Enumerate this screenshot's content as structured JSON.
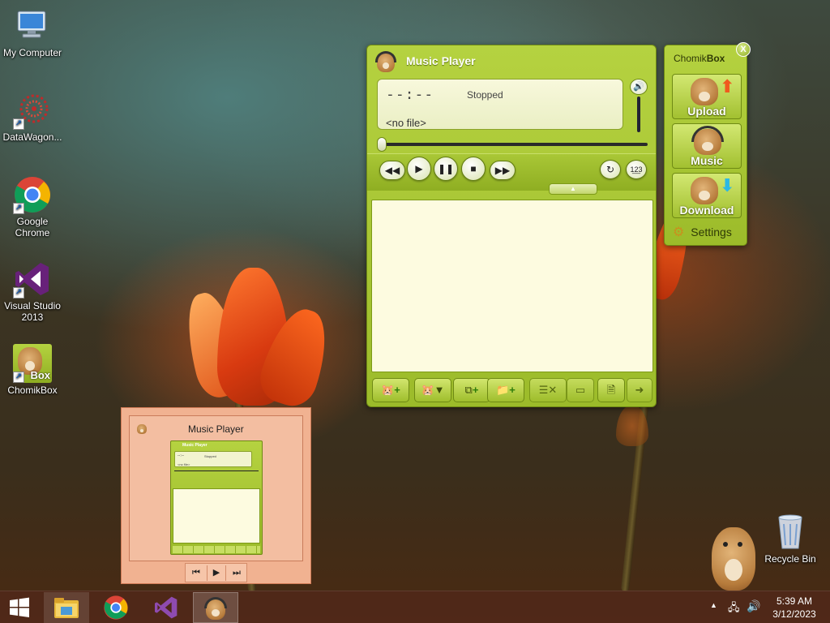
{
  "desktop": {
    "icons": [
      {
        "label": "My Computer",
        "icon": "computer-icon"
      },
      {
        "label": "DataWagon...",
        "icon": "datawagon-icon"
      },
      {
        "label": "Google Chrome",
        "icon": "chrome-icon"
      },
      {
        "label": "Visual Studio 2013",
        "icon": "visual-studio-icon"
      },
      {
        "label": "ChomikBox",
        "icon": "chomikbox-icon",
        "badge": "Box"
      }
    ],
    "recycle_bin": {
      "label": "Recycle Bin",
      "icon": "recycle-bin-icon"
    }
  },
  "music_player": {
    "title": "Music Player",
    "time": "--:--",
    "status": "Stopped",
    "file": "<no file>",
    "progress": 0,
    "controls": {
      "rewind": "rewind-icon",
      "play": "play-icon",
      "pause": "pause-icon",
      "stop": "stop-icon",
      "forward": "fast-forward-icon",
      "repeat": "repeat-icon",
      "shuffle": "shuffle-icon",
      "volume": "speaker-icon"
    },
    "toolbar": [
      "add-file",
      "sort",
      "add-url",
      "add-folder",
      "remove",
      "new-playlist",
      "save-playlist",
      "open-playlist"
    ]
  },
  "chomikbox": {
    "title_prefix": "Chomik",
    "title_bold": "Box",
    "close": "X",
    "buttons": [
      {
        "label": "Upload",
        "arrow": "upload-arrow-icon",
        "arrow_color": "#f05a1e"
      },
      {
        "label": "Music",
        "arrow": "headphones-icon"
      },
      {
        "label": "Download",
        "arrow": "download-arrow-icon",
        "arrow_color": "#2bb8e6"
      }
    ],
    "settings": "Settings"
  },
  "thumbnail": {
    "title": "Music Player",
    "mini_title": "Music Player",
    "mini_time": "--:--",
    "mini_status": "Stopped",
    "mini_file": "<no file>"
  },
  "taskbar": {
    "clock_time": "5:39 AM",
    "clock_date": "3/12/2023"
  },
  "colors": {
    "accent_green": "#9cbb2a",
    "taskbar": "#502819"
  }
}
